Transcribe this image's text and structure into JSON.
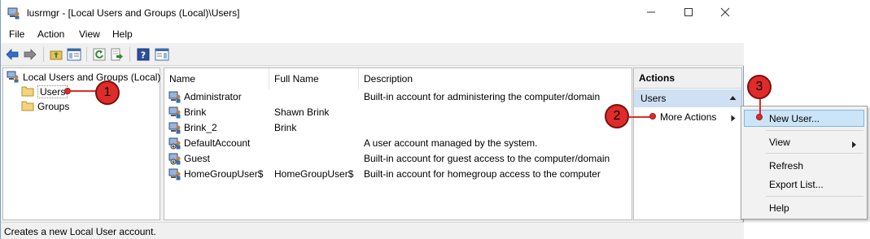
{
  "window": {
    "title": "lusrmgr - [Local Users and Groups (Local)\\Users]",
    "app_icon": "computer-users-icon",
    "controls": [
      "minimize-icon",
      "maximize-icon",
      "close-icon"
    ]
  },
  "menu": {
    "file": "File",
    "action": "Action",
    "view": "View",
    "help": "Help"
  },
  "toolbar": {
    "icons": [
      "back-arrow-icon",
      "forward-arrow-icon",
      "up-folder-icon",
      "show-hide-tree-icon",
      "refresh-icon",
      "export-list-icon",
      "help-icon",
      "show-hide-action-pane-icon"
    ]
  },
  "tree": {
    "root": "Local Users and Groups (Local)",
    "items": [
      {
        "label": "Users"
      },
      {
        "label": "Groups"
      }
    ]
  },
  "list": {
    "columns": [
      "Name",
      "Full Name",
      "Description"
    ],
    "rows": [
      {
        "name": "Administrator",
        "full_name": "",
        "description": "Built-in account for administering the computer/domain"
      },
      {
        "name": "Brink",
        "full_name": "Shawn Brink",
        "description": ""
      },
      {
        "name": "Brink_2",
        "full_name": "Brink",
        "description": ""
      },
      {
        "name": "DefaultAccount",
        "full_name": "",
        "description": "A user account managed by the system."
      },
      {
        "name": "Guest",
        "full_name": "",
        "description": "Built-in account for guest access to the computer/domain"
      },
      {
        "name": "HomeGroupUser$",
        "full_name": "HomeGroupUser$",
        "description": "Built-in account for homegroup access to the computer"
      }
    ]
  },
  "actions": {
    "header": "Actions",
    "section": "Users",
    "more_actions": "More Actions"
  },
  "context_menu": {
    "new_user": "New User...",
    "view": "View",
    "refresh": "Refresh",
    "export_list": "Export List...",
    "help": "Help"
  },
  "status": {
    "text": "Creates a new Local User account."
  },
  "callouts": {
    "one": "1",
    "two": "2",
    "three": "3"
  },
  "colors": {
    "callout_red": "#e02b2b",
    "selection_blue": "#cce4f7",
    "actions_section_bg": "#cfe0f3"
  }
}
